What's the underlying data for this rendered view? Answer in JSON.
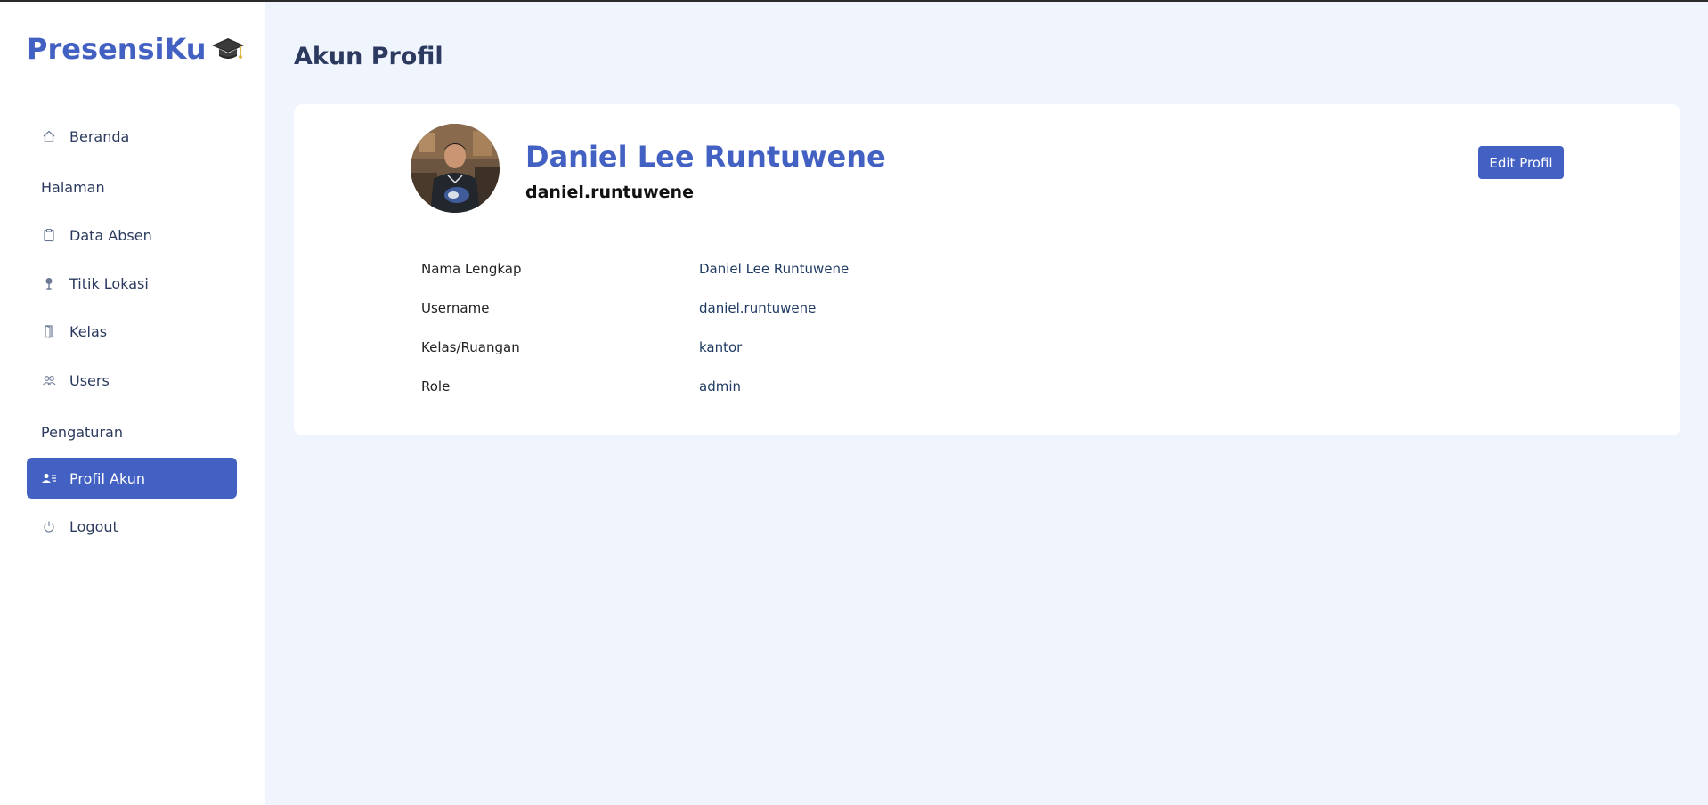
{
  "app": {
    "brand": "PresensiKu"
  },
  "sidebar": {
    "items": [
      {
        "label": "Beranda",
        "icon": "home-icon"
      },
      {
        "label": "Data Absen",
        "icon": "clipboard-icon"
      },
      {
        "label": "Titik Lokasi",
        "icon": "map-pin-icon"
      },
      {
        "label": "Kelas",
        "icon": "door-icon"
      },
      {
        "label": "Users",
        "icon": "users-icon"
      },
      {
        "label": "Profil Akun",
        "icon": "profile-card-icon",
        "active": true
      },
      {
        "label": "Logout",
        "icon": "power-icon"
      }
    ],
    "sections": [
      "Halaman",
      "Pengaturan"
    ]
  },
  "main": {
    "title": "Akun Profil",
    "profile": {
      "full_name": "Daniel Lee Runtuwene",
      "username": "daniel.runtuwene",
      "edit_label": "Edit Profil"
    },
    "details": [
      {
        "label": "Nama Lengkap",
        "value": "Daniel Lee Runtuwene"
      },
      {
        "label": "Username",
        "value": "daniel.runtuwene"
      },
      {
        "label": "Kelas/Ruangan",
        "value": "kantor"
      },
      {
        "label": "Role",
        "value": "admin"
      }
    ]
  },
  "colors": {
    "accent": "#4361c2",
    "background": "#f0f5fd",
    "text": "#2b3a5e"
  }
}
